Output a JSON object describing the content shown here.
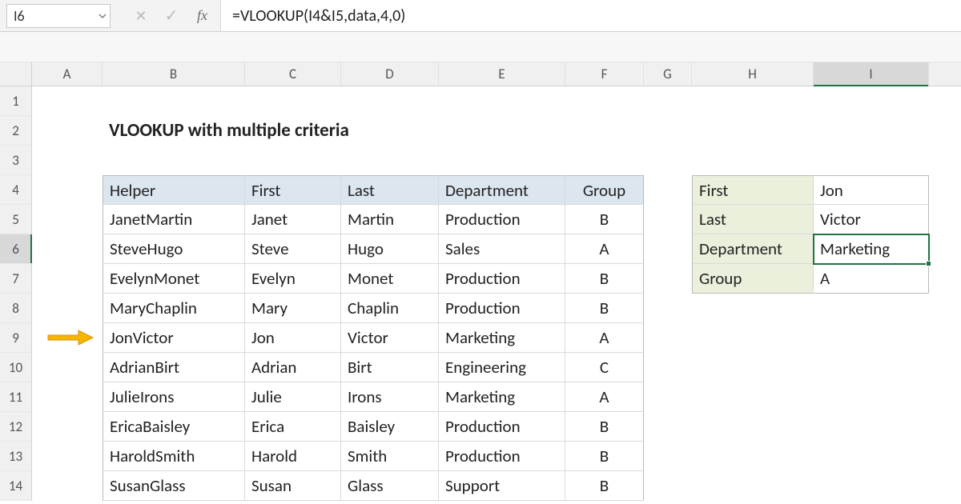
{
  "namebox": "I6",
  "formula": "=VLOOKUP(I4&I5,data,4,0)",
  "columns": [
    "A",
    "B",
    "C",
    "D",
    "E",
    "F",
    "G",
    "H",
    "I"
  ],
  "row_labels": [
    "1",
    "2",
    "3",
    "4",
    "5",
    "6",
    "7",
    "8",
    "9",
    "10",
    "11",
    "12",
    "13",
    "14"
  ],
  "active_col": "I",
  "active_row": "6",
  "title": "VLOOKUP with multiple criteria",
  "main_table": {
    "headers": [
      "Helper",
      "First",
      "Last",
      "Department",
      "Group"
    ],
    "rows": [
      {
        "helper": "JanetMartin",
        "first": "Janet",
        "last": "Martin",
        "dept": "Production",
        "group": "B"
      },
      {
        "helper": "SteveHugo",
        "first": "Steve",
        "last": "Hugo",
        "dept": "Sales",
        "group": "A"
      },
      {
        "helper": "EvelynMonet",
        "first": "Evelyn",
        "last": "Monet",
        "dept": "Production",
        "group": "B"
      },
      {
        "helper": "MaryChaplin",
        "first": "Mary",
        "last": "Chaplin",
        "dept": "Production",
        "group": "B"
      },
      {
        "helper": "JonVictor",
        "first": "Jon",
        "last": "Victor",
        "dept": "Marketing",
        "group": "A"
      },
      {
        "helper": "AdrianBirt",
        "first": "Adrian",
        "last": "Birt",
        "dept": "Engineering",
        "group": "C"
      },
      {
        "helper": "JulieIrons",
        "first": "Julie",
        "last": "Irons",
        "dept": "Marketing",
        "group": "A"
      },
      {
        "helper": "EricaBaisley",
        "first": "Erica",
        "last": "Baisley",
        "dept": "Production",
        "group": "B"
      },
      {
        "helper": "HaroldSmith",
        "first": "Harold",
        "last": "Smith",
        "dept": "Production",
        "group": "B"
      },
      {
        "helper": "SusanGlass",
        "first": "Susan",
        "last": "Glass",
        "dept": "Support",
        "group": "B"
      }
    ]
  },
  "lookup_box": {
    "rows": [
      {
        "label": "First",
        "value": "Jon"
      },
      {
        "label": "Last",
        "value": "Victor"
      },
      {
        "label": "Department",
        "value": "Marketing"
      },
      {
        "label": "Group",
        "value": "A"
      }
    ]
  },
  "icons": {
    "fx": "fx"
  },
  "colors": {
    "selection": "#217346",
    "header_blue": "#dbe6ef",
    "header_green": "#eaf0dc",
    "arrow": "#f2b200"
  }
}
